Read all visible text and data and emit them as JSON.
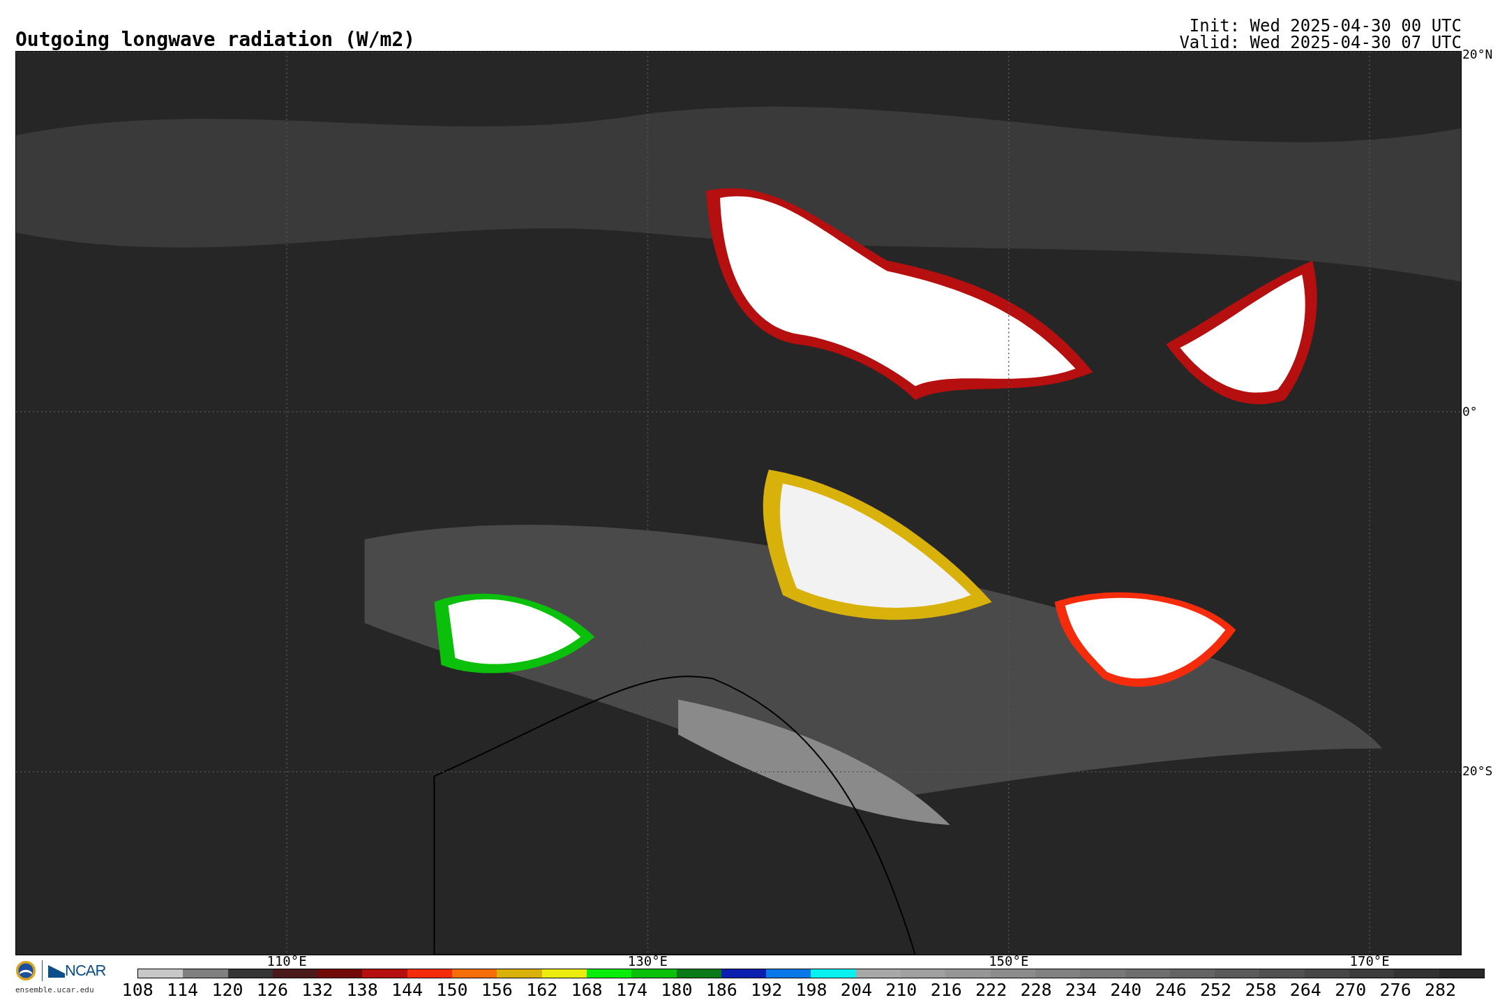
{
  "title": "Outgoing longwave radiation (W/m2)",
  "init": "Init: Wed 2025-04-30 00 UTC",
  "valid": "Valid: Wed 2025-04-30 07 UTC",
  "map": {
    "lat_labels": [
      "20°N",
      "0°",
      "20°S"
    ],
    "lon_labels": [
      "110°E",
      "130°E",
      "150°E",
      "170°E"
    ]
  },
  "footer": {
    "org": "NCAR",
    "site": "ensemble.ucar.edu"
  },
  "colorbar": {
    "bins": [
      {
        "color": "#c8c8c8"
      },
      {
        "color": "#808080"
      },
      {
        "color": "#353535"
      },
      {
        "color": "#4a1a1a"
      },
      {
        "color": "#720a0a"
      },
      {
        "color": "#b50f0f"
      },
      {
        "color": "#f52c0c"
      },
      {
        "color": "#f56e0a"
      },
      {
        "color": "#d8b10a"
      },
      {
        "color": "#ecec0e"
      },
      {
        "color": "#0aec0a"
      },
      {
        "color": "#0ac00a"
      },
      {
        "color": "#0a7a18"
      },
      {
        "color": "#0a1faf"
      },
      {
        "color": "#0a78e8"
      },
      {
        "color": "#0af0f0"
      },
      {
        "color": "#a8a8a8"
      },
      {
        "color": "#a0a0a0"
      },
      {
        "color": "#969696"
      },
      {
        "color": "#8c8c8c"
      },
      {
        "color": "#828282"
      },
      {
        "color": "#787878"
      },
      {
        "color": "#6e6e6e"
      },
      {
        "color": "#646464"
      },
      {
        "color": "#5a5a5a"
      },
      {
        "color": "#505050"
      },
      {
        "color": "#464646"
      },
      {
        "color": "#3c3c3c"
      },
      {
        "color": "#323232"
      },
      {
        "color": "#282828"
      }
    ],
    "ticks": [
      "108",
      "114",
      "120",
      "126",
      "132",
      "138",
      "144",
      "150",
      "156",
      "162",
      "168",
      "174",
      "180",
      "186",
      "192",
      "198",
      "204",
      "210",
      "216",
      "222",
      "228",
      "234",
      "240",
      "246",
      "252",
      "258",
      "264",
      "270",
      "276",
      "282"
    ]
  }
}
